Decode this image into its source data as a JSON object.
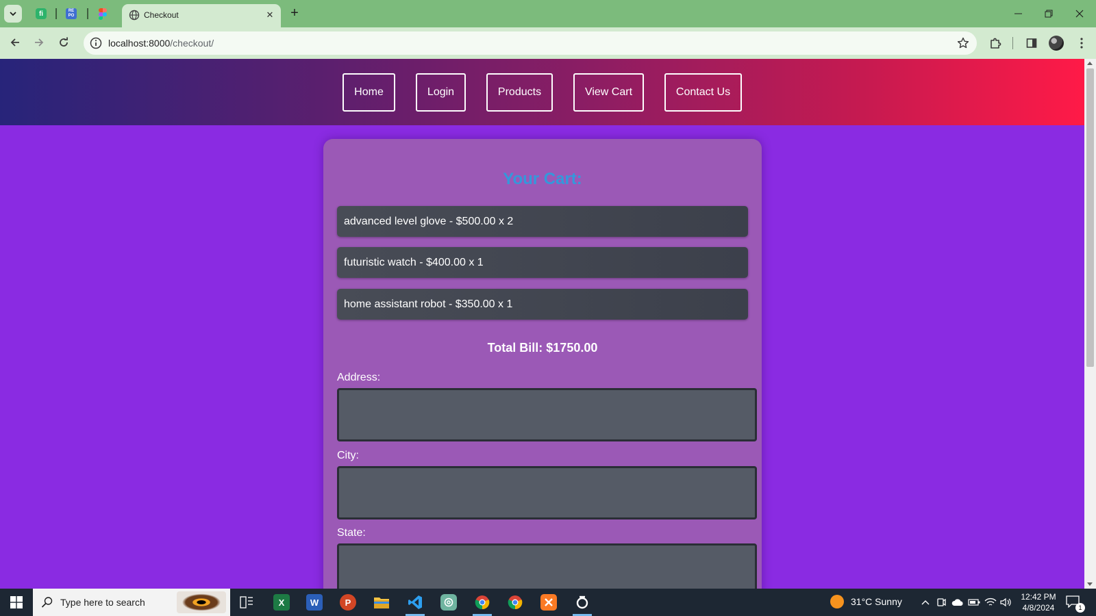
{
  "browser": {
    "active_tab_title": "Checkout",
    "url_host": "localhost:8000",
    "url_path": "/checkout/",
    "pinned_tabs": [
      "fi-icon",
      "re-po-icon",
      "figma-icon"
    ],
    "pinned_re_label_top": "RE",
    "pinned_re_label_bottom": "PO",
    "pinned_fi_label": "fi"
  },
  "nav": {
    "links": [
      {
        "label": "Home"
      },
      {
        "label": "Login"
      },
      {
        "label": "Products"
      },
      {
        "label": "View Cart"
      },
      {
        "label": "Contact Us"
      }
    ]
  },
  "cart": {
    "heading": "Your Cart:",
    "items": [
      {
        "text": "advanced level glove - $500.00 x 2"
      },
      {
        "text": "futuristic watch - $400.00 x 1"
      },
      {
        "text": "home assistant robot - $350.00 x 1"
      }
    ],
    "total": "Total Bill: $1750.00"
  },
  "form": {
    "address_label": "Address:",
    "address_value": "",
    "city_label": "City:",
    "city_value": "",
    "state_label": "State:",
    "state_value": ""
  },
  "taskbar": {
    "search_placeholder": "Type here to search",
    "weather": "31°C  Sunny",
    "time": "12:42 PM",
    "date": "4/8/2024",
    "notification_count": "1",
    "excel_letter": "X",
    "word_letter": "W",
    "powerpoint_letter": "P"
  },
  "colors": {
    "page_bg": "#8a2be2",
    "card_bg": "#9b59b6",
    "heading": "#3498db",
    "nav_gradient_start": "#27247a",
    "nav_gradient_end": "#ff1a47",
    "tab_strip": "#7cbb7c"
  }
}
